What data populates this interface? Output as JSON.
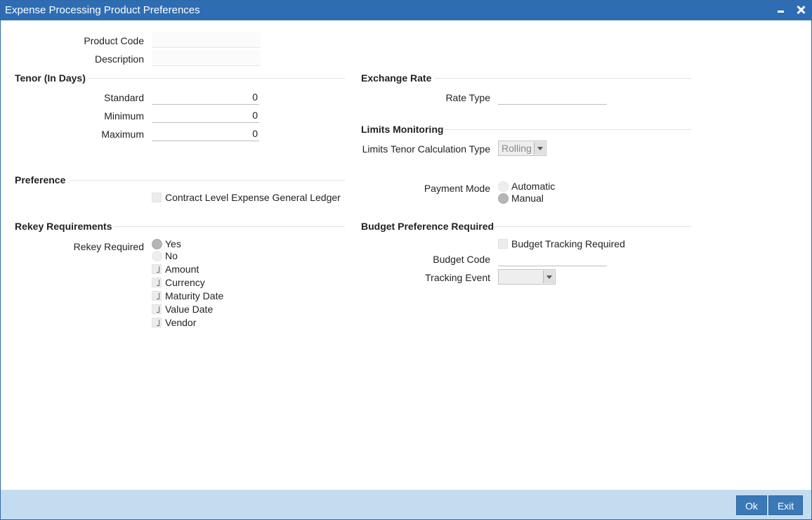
{
  "window": {
    "title": "Expense Processing Product Preferences"
  },
  "product": {
    "code_label": "Product Code",
    "description_label": "Description",
    "code": "",
    "description": ""
  },
  "tenor": {
    "section": "Tenor (In Days)",
    "standard_label": "Standard",
    "standard": "0",
    "minimum_label": "Minimum",
    "minimum": "0",
    "maximum_label": "Maximum",
    "maximum": "0"
  },
  "exchange": {
    "section": "Exchange Rate",
    "rate_type_label": "Rate Type",
    "rate_type": ""
  },
  "limits": {
    "section": "Limits Monitoring",
    "tenor_calc_label": "Limits Tenor Calculation Type",
    "tenor_calc_value": "Rolling"
  },
  "preference": {
    "section": "Preference",
    "contract_gl_label": "Contract Level Expense General Ledger",
    "contract_gl_checked": false
  },
  "payment": {
    "label": "Payment Mode",
    "automatic": "Automatic",
    "manual": "Manual",
    "selected": "Manual"
  },
  "rekey": {
    "section": "Rekey Requirements",
    "required_label": "Rekey Required",
    "yes": "Yes",
    "no": "No",
    "selected": "Yes",
    "fields": [
      "Amount",
      "Currency",
      "Maturity Date",
      "Value Date",
      "Vendor"
    ]
  },
  "budget": {
    "section": "Budget Preference Required",
    "tracking_required_label": "Budget Tracking Required",
    "code_label": "Budget Code",
    "code": "",
    "tracking_event_label": "Tracking Event",
    "tracking_event": ""
  },
  "footer": {
    "ok": "Ok",
    "exit": "Exit"
  },
  "colors": {
    "titlebar": "#2e6db3",
    "footer": "#c4dcf0",
    "button": "#3b78b7"
  },
  "icons": {
    "minimize": "minimize-icon",
    "close": "close-icon",
    "dropdown": "chevron-down-icon"
  }
}
